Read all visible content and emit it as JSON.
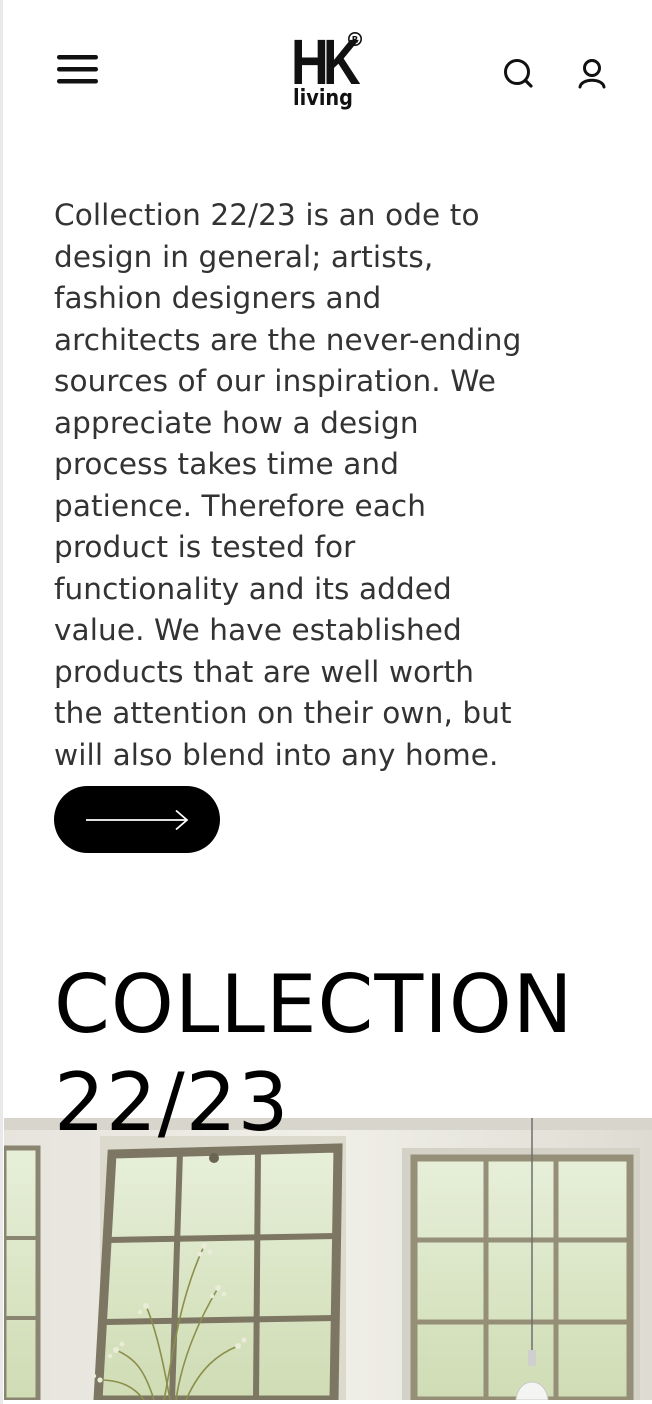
{
  "header": {
    "menu_icon": "hamburger-menu-icon",
    "logo": {
      "brand_letters": "HK",
      "brand_word": "living",
      "registered_mark": "®"
    },
    "search_icon": "search-icon",
    "account_icon": "user-icon"
  },
  "intro": {
    "text": "Collection 22/23 is an ode to design in general; artists, fashion designers and architects are the never-ending sources of our inspiration. We appreciate how a design process takes time and patience. Therefore each product is tested for functionality and its added value. We have established products that are well worth the attention on their own, but will also blend into any home."
  },
  "cta": {
    "icon": "arrow-right-icon",
    "background": "#000000"
  },
  "collection": {
    "heading_line1": "COLLECTION",
    "heading_line2": "22/23"
  },
  "hero_image": {
    "subject": "interior with tall paned windows, dried flower branches and a pendant lamp"
  }
}
